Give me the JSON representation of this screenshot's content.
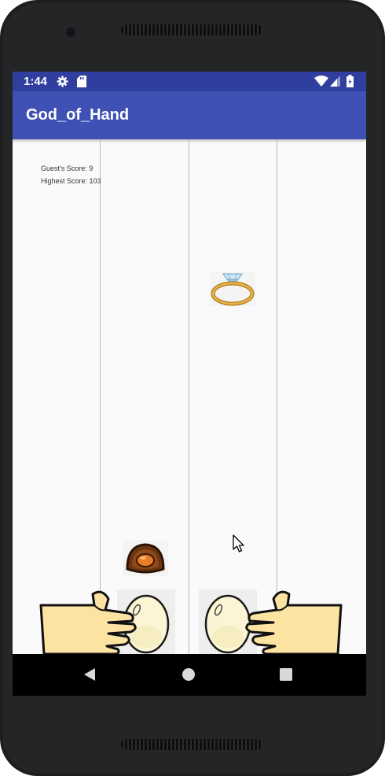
{
  "status_bar": {
    "time": "1:44",
    "icons": [
      "gear-icon",
      "sd-card-icon",
      "wifi-icon",
      "signal-icon",
      "battery-icon"
    ],
    "color": "#303f9f"
  },
  "app_bar": {
    "title": "God_of_Hand",
    "color": "#3f51b5"
  },
  "game": {
    "guest_score_text": "Guest's Score: 9",
    "highest_score_text": "Highest Score: 103",
    "falling_items": [
      "ring-icon",
      "chocolate-egg-icon"
    ],
    "player_items": [
      "left-hand",
      "left-egg",
      "right-egg",
      "right-hand"
    ]
  },
  "nav_bar": {
    "buttons": [
      "back-button",
      "home-button",
      "recents-button"
    ]
  }
}
